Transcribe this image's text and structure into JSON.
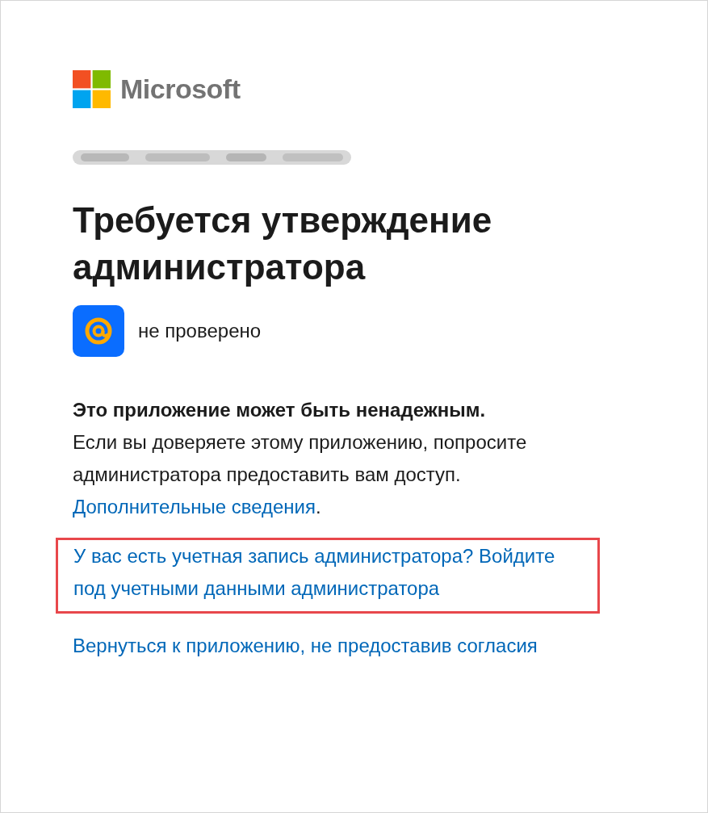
{
  "brand": {
    "name": "Microsoft"
  },
  "heading": "Требуется утверждение администратора",
  "app": {
    "status": "не проверено"
  },
  "warning": {
    "title": "Это приложение может быть ненадежным.",
    "text": "Если вы доверяете этому приложению, попросите администратора предоставить вам доступ.",
    "link": "Дополнительные сведения",
    "after": "."
  },
  "links": [
    {
      "text": "У вас есть учетная запись администратора? Войдите под учетными данными администратора",
      "highlighted": true
    },
    {
      "text": "Вернуться к приложению, не предоставив согласия",
      "highlighted": false
    }
  ]
}
